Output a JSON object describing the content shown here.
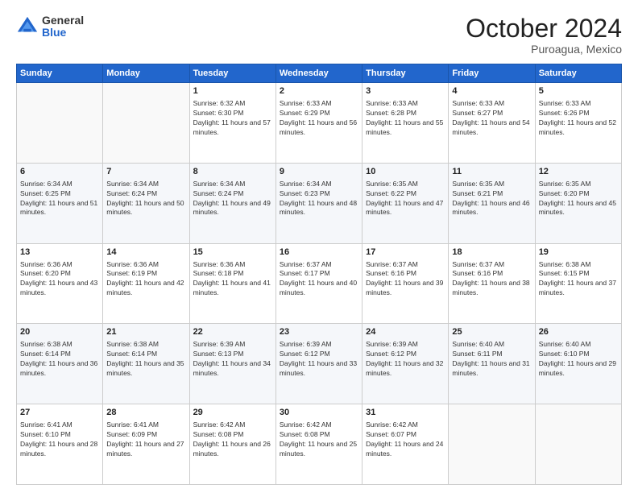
{
  "header": {
    "logo_general": "General",
    "logo_blue": "Blue",
    "month": "October 2024",
    "location": "Puroagua, Mexico"
  },
  "weekdays": [
    "Sunday",
    "Monday",
    "Tuesday",
    "Wednesday",
    "Thursday",
    "Friday",
    "Saturday"
  ],
  "weeks": [
    [
      {
        "day": "",
        "info": ""
      },
      {
        "day": "",
        "info": ""
      },
      {
        "day": "1",
        "info": "Sunrise: 6:32 AM\nSunset: 6:30 PM\nDaylight: 11 hours and 57 minutes."
      },
      {
        "day": "2",
        "info": "Sunrise: 6:33 AM\nSunset: 6:29 PM\nDaylight: 11 hours and 56 minutes."
      },
      {
        "day": "3",
        "info": "Sunrise: 6:33 AM\nSunset: 6:28 PM\nDaylight: 11 hours and 55 minutes."
      },
      {
        "day": "4",
        "info": "Sunrise: 6:33 AM\nSunset: 6:27 PM\nDaylight: 11 hours and 54 minutes."
      },
      {
        "day": "5",
        "info": "Sunrise: 6:33 AM\nSunset: 6:26 PM\nDaylight: 11 hours and 52 minutes."
      }
    ],
    [
      {
        "day": "6",
        "info": "Sunrise: 6:34 AM\nSunset: 6:25 PM\nDaylight: 11 hours and 51 minutes."
      },
      {
        "day": "7",
        "info": "Sunrise: 6:34 AM\nSunset: 6:24 PM\nDaylight: 11 hours and 50 minutes."
      },
      {
        "day": "8",
        "info": "Sunrise: 6:34 AM\nSunset: 6:24 PM\nDaylight: 11 hours and 49 minutes."
      },
      {
        "day": "9",
        "info": "Sunrise: 6:34 AM\nSunset: 6:23 PM\nDaylight: 11 hours and 48 minutes."
      },
      {
        "day": "10",
        "info": "Sunrise: 6:35 AM\nSunset: 6:22 PM\nDaylight: 11 hours and 47 minutes."
      },
      {
        "day": "11",
        "info": "Sunrise: 6:35 AM\nSunset: 6:21 PM\nDaylight: 11 hours and 46 minutes."
      },
      {
        "day": "12",
        "info": "Sunrise: 6:35 AM\nSunset: 6:20 PM\nDaylight: 11 hours and 45 minutes."
      }
    ],
    [
      {
        "day": "13",
        "info": "Sunrise: 6:36 AM\nSunset: 6:20 PM\nDaylight: 11 hours and 43 minutes."
      },
      {
        "day": "14",
        "info": "Sunrise: 6:36 AM\nSunset: 6:19 PM\nDaylight: 11 hours and 42 minutes."
      },
      {
        "day": "15",
        "info": "Sunrise: 6:36 AM\nSunset: 6:18 PM\nDaylight: 11 hours and 41 minutes."
      },
      {
        "day": "16",
        "info": "Sunrise: 6:37 AM\nSunset: 6:17 PM\nDaylight: 11 hours and 40 minutes."
      },
      {
        "day": "17",
        "info": "Sunrise: 6:37 AM\nSunset: 6:16 PM\nDaylight: 11 hours and 39 minutes."
      },
      {
        "day": "18",
        "info": "Sunrise: 6:37 AM\nSunset: 6:16 PM\nDaylight: 11 hours and 38 minutes."
      },
      {
        "day": "19",
        "info": "Sunrise: 6:38 AM\nSunset: 6:15 PM\nDaylight: 11 hours and 37 minutes."
      }
    ],
    [
      {
        "day": "20",
        "info": "Sunrise: 6:38 AM\nSunset: 6:14 PM\nDaylight: 11 hours and 36 minutes."
      },
      {
        "day": "21",
        "info": "Sunrise: 6:38 AM\nSunset: 6:14 PM\nDaylight: 11 hours and 35 minutes."
      },
      {
        "day": "22",
        "info": "Sunrise: 6:39 AM\nSunset: 6:13 PM\nDaylight: 11 hours and 34 minutes."
      },
      {
        "day": "23",
        "info": "Sunrise: 6:39 AM\nSunset: 6:12 PM\nDaylight: 11 hours and 33 minutes."
      },
      {
        "day": "24",
        "info": "Sunrise: 6:39 AM\nSunset: 6:12 PM\nDaylight: 11 hours and 32 minutes."
      },
      {
        "day": "25",
        "info": "Sunrise: 6:40 AM\nSunset: 6:11 PM\nDaylight: 11 hours and 31 minutes."
      },
      {
        "day": "26",
        "info": "Sunrise: 6:40 AM\nSunset: 6:10 PM\nDaylight: 11 hours and 29 minutes."
      }
    ],
    [
      {
        "day": "27",
        "info": "Sunrise: 6:41 AM\nSunset: 6:10 PM\nDaylight: 11 hours and 28 minutes."
      },
      {
        "day": "28",
        "info": "Sunrise: 6:41 AM\nSunset: 6:09 PM\nDaylight: 11 hours and 27 minutes."
      },
      {
        "day": "29",
        "info": "Sunrise: 6:42 AM\nSunset: 6:08 PM\nDaylight: 11 hours and 26 minutes."
      },
      {
        "day": "30",
        "info": "Sunrise: 6:42 AM\nSunset: 6:08 PM\nDaylight: 11 hours and 25 minutes."
      },
      {
        "day": "31",
        "info": "Sunrise: 6:42 AM\nSunset: 6:07 PM\nDaylight: 11 hours and 24 minutes."
      },
      {
        "day": "",
        "info": ""
      },
      {
        "day": "",
        "info": ""
      }
    ]
  ]
}
